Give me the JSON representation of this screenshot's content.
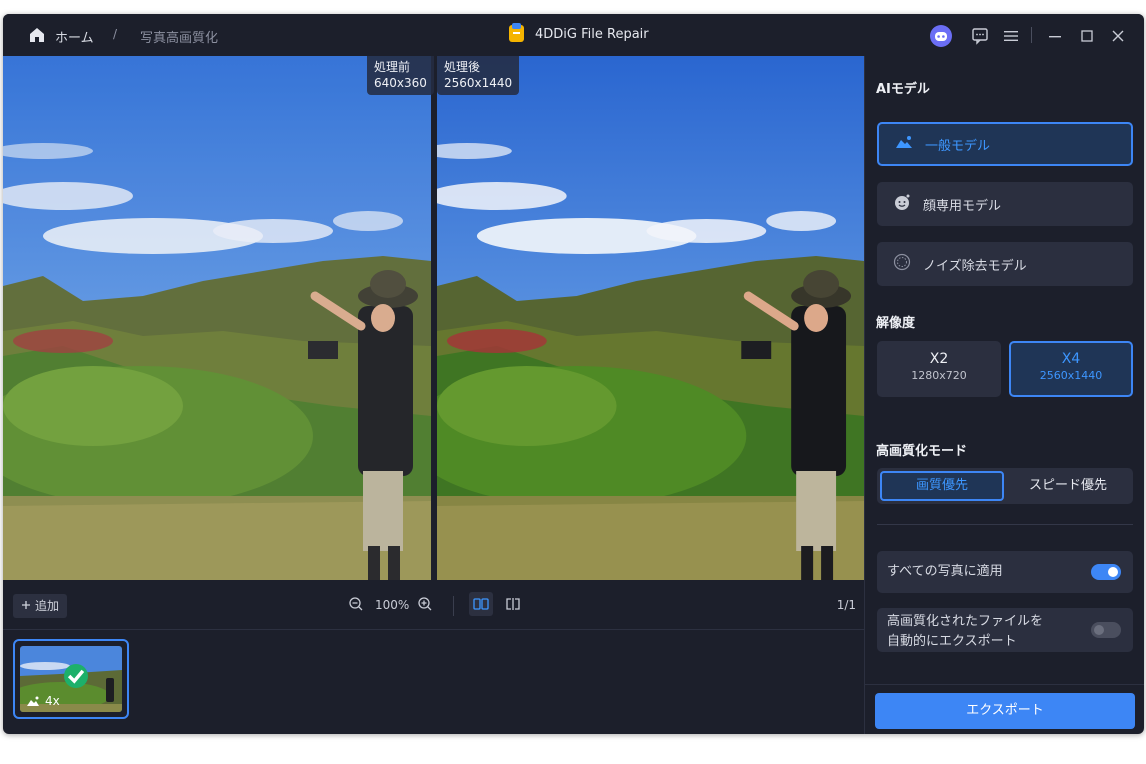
{
  "titlebar": {
    "breadcrumb_home": "ホーム",
    "breadcrumb_separator": "/",
    "breadcrumb_current": "写真高画質化",
    "app_title": "4DDiG File Repair"
  },
  "preview": {
    "before_label": "処理前",
    "before_size": "640x360",
    "after_label": "処理後",
    "after_size": "2560x1440"
  },
  "toolbar": {
    "add_label": "追加",
    "zoom_level": "100%",
    "page_count": "1/1"
  },
  "thumbnail": {
    "scale_badge": "4x"
  },
  "panel": {
    "ai_model_title": "AIモデル",
    "models": [
      {
        "label": "一般モデル",
        "icon": "landscape-icon",
        "active": true
      },
      {
        "label": "顔専用モデル",
        "icon": "face-icon",
        "active": false
      },
      {
        "label": "ノイズ除去モデル",
        "icon": "noise-icon",
        "active": false
      }
    ],
    "resolution_title": "解像度",
    "resolutions": [
      {
        "label": "X2",
        "size": "1280x720",
        "active": false
      },
      {
        "label": "X4",
        "size": "2560x1440",
        "active": true
      }
    ],
    "mode_title": "高画質化モード",
    "mode_quality": "画質優先",
    "mode_speed": "スピード優先",
    "apply_all_label": "すべての写真に適用",
    "apply_all_on": true,
    "auto_export_line1": "高画質化されたファイルを",
    "auto_export_line2": "自動的にエクスポート",
    "auto_export_on": false,
    "export_label": "エクスポート"
  },
  "colors": {
    "accent": "#3d86f5",
    "background": "#1c1f2b",
    "card": "#2b2f3f",
    "success": "#1db06a"
  }
}
